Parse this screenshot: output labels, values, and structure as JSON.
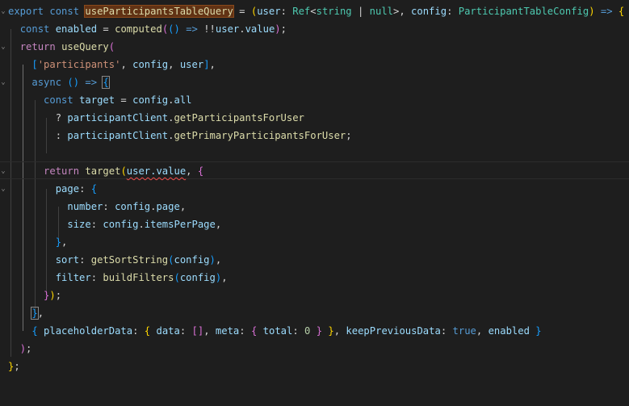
{
  "editor": {
    "theme_colors": {
      "background": "#1e1e1e",
      "keyword": "#569cd6",
      "control": "#c586c0",
      "function": "#dcdcaa",
      "variable": "#9cdcfe",
      "type": "#4ec9b0",
      "string": "#ce9178",
      "number": "#b5cea8"
    },
    "lines": [
      {
        "fold": "chevron-down-icon",
        "tokens": [
          {
            "c": "kw",
            "t": "export"
          },
          {
            "c": "plain",
            "t": " "
          },
          {
            "c": "kw",
            "t": "const"
          },
          {
            "c": "plain",
            "t": " "
          },
          {
            "c": "fn hl",
            "t": "useParticipantsTableQuery"
          },
          {
            "c": "plain",
            "t": " = "
          },
          {
            "c": "b1",
            "t": "("
          },
          {
            "c": "var",
            "t": "user"
          },
          {
            "c": "plain",
            "t": ": "
          },
          {
            "c": "type",
            "t": "Ref"
          },
          {
            "c": "plain",
            "t": "<"
          },
          {
            "c": "type",
            "t": "string"
          },
          {
            "c": "plain",
            "t": " | "
          },
          {
            "c": "type",
            "t": "null"
          },
          {
            "c": "plain",
            "t": ">, "
          },
          {
            "c": "var",
            "t": "config"
          },
          {
            "c": "plain",
            "t": ": "
          },
          {
            "c": "type",
            "t": "ParticipantTableConfig"
          },
          {
            "c": "b1",
            "t": ")"
          },
          {
            "c": "plain",
            "t": " "
          },
          {
            "c": "kw",
            "t": "=>"
          },
          {
            "c": "plain",
            "t": " "
          },
          {
            "c": "b1",
            "t": "{"
          }
        ]
      },
      {
        "fold": "",
        "tokens": [
          {
            "c": "plain",
            "t": "  "
          },
          {
            "c": "kw",
            "t": "const"
          },
          {
            "c": "plain",
            "t": " "
          },
          {
            "c": "var",
            "t": "enabled"
          },
          {
            "c": "plain",
            "t": " = "
          },
          {
            "c": "fn",
            "t": "computed"
          },
          {
            "c": "b2",
            "t": "("
          },
          {
            "c": "b3",
            "t": "()"
          },
          {
            "c": "plain",
            "t": " "
          },
          {
            "c": "kw",
            "t": "=>"
          },
          {
            "c": "plain",
            "t": " !!"
          },
          {
            "c": "var",
            "t": "user"
          },
          {
            "c": "plain",
            "t": "."
          },
          {
            "c": "var",
            "t": "value"
          },
          {
            "c": "b2",
            "t": ")"
          },
          {
            "c": "plain",
            "t": ";"
          }
        ]
      },
      {
        "fold": "chevron-down-icon",
        "tokens": [
          {
            "c": "plain",
            "t": "  "
          },
          {
            "c": "ctl",
            "t": "return"
          },
          {
            "c": "plain",
            "t": " "
          },
          {
            "c": "fn",
            "t": "useQuery"
          },
          {
            "c": "b2",
            "t": "("
          }
        ]
      },
      {
        "fold": "",
        "tokens": [
          {
            "c": "plain",
            "t": "    "
          },
          {
            "c": "b3",
            "t": "["
          },
          {
            "c": "str",
            "t": "'participants'"
          },
          {
            "c": "plain",
            "t": ", "
          },
          {
            "c": "var",
            "t": "config"
          },
          {
            "c": "plain",
            "t": ", "
          },
          {
            "c": "var",
            "t": "user"
          },
          {
            "c": "b3",
            "t": "]"
          },
          {
            "c": "plain",
            "t": ","
          }
        ]
      },
      {
        "fold": "chevron-down-icon",
        "tokens": [
          {
            "c": "plain",
            "t": "    "
          },
          {
            "c": "kw",
            "t": "async"
          },
          {
            "c": "plain",
            "t": " "
          },
          {
            "c": "b3",
            "t": "()"
          },
          {
            "c": "plain",
            "t": " "
          },
          {
            "c": "kw",
            "t": "=>"
          },
          {
            "c": "plain",
            "t": " "
          },
          {
            "c": "b3 bm",
            "t": "{"
          }
        ]
      },
      {
        "fold": "",
        "tokens": [
          {
            "c": "plain",
            "t": "      "
          },
          {
            "c": "kw",
            "t": "const"
          },
          {
            "c": "plain",
            "t": " "
          },
          {
            "c": "var",
            "t": "target"
          },
          {
            "c": "plain",
            "t": " = "
          },
          {
            "c": "var",
            "t": "config"
          },
          {
            "c": "plain",
            "t": "."
          },
          {
            "c": "var",
            "t": "all"
          }
        ]
      },
      {
        "fold": "",
        "tokens": [
          {
            "c": "plain",
            "t": "        ? "
          },
          {
            "c": "var",
            "t": "participantClient"
          },
          {
            "c": "plain",
            "t": "."
          },
          {
            "c": "fn",
            "t": "getParticipantsForUser"
          }
        ]
      },
      {
        "fold": "",
        "tokens": [
          {
            "c": "plain",
            "t": "        : "
          },
          {
            "c": "var",
            "t": "participantClient"
          },
          {
            "c": "plain",
            "t": "."
          },
          {
            "c": "fn",
            "t": "getPrimaryParticipantsForUser"
          },
          {
            "c": "plain",
            "t": ";"
          }
        ]
      },
      {
        "fold": "",
        "tokens": []
      },
      {
        "fold": "chevron-down-icon",
        "tokens": [
          {
            "c": "plain",
            "t": "      "
          },
          {
            "c": "ctl",
            "t": "return"
          },
          {
            "c": "plain",
            "t": " "
          },
          {
            "c": "fn",
            "t": "target"
          },
          {
            "c": "b1",
            "t": "("
          },
          {
            "c": "var squig",
            "t": "user.value"
          },
          {
            "c": "plain",
            "t": ", "
          },
          {
            "c": "b2",
            "t": "{"
          }
        ]
      },
      {
        "fold": "chevron-down-icon",
        "tokens": [
          {
            "c": "plain",
            "t": "        "
          },
          {
            "c": "var",
            "t": "page"
          },
          {
            "c": "plain",
            "t": ": "
          },
          {
            "c": "b3",
            "t": "{"
          }
        ]
      },
      {
        "fold": "",
        "tokens": [
          {
            "c": "plain",
            "t": "          "
          },
          {
            "c": "var",
            "t": "number"
          },
          {
            "c": "plain",
            "t": ": "
          },
          {
            "c": "var",
            "t": "config"
          },
          {
            "c": "plain",
            "t": "."
          },
          {
            "c": "var",
            "t": "page"
          },
          {
            "c": "plain",
            "t": ","
          }
        ]
      },
      {
        "fold": "",
        "tokens": [
          {
            "c": "plain",
            "t": "          "
          },
          {
            "c": "var",
            "t": "size"
          },
          {
            "c": "plain",
            "t": ": "
          },
          {
            "c": "var",
            "t": "config"
          },
          {
            "c": "plain",
            "t": "."
          },
          {
            "c": "var",
            "t": "itemsPerPage"
          },
          {
            "c": "plain",
            "t": ","
          }
        ]
      },
      {
        "fold": "",
        "tokens": [
          {
            "c": "plain",
            "t": "        "
          },
          {
            "c": "b3",
            "t": "}"
          },
          {
            "c": "plain",
            "t": ","
          }
        ]
      },
      {
        "fold": "",
        "tokens": [
          {
            "c": "plain",
            "t": "        "
          },
          {
            "c": "var",
            "t": "sort"
          },
          {
            "c": "plain",
            "t": ": "
          },
          {
            "c": "fn",
            "t": "getSortString"
          },
          {
            "c": "b3",
            "t": "("
          },
          {
            "c": "var",
            "t": "config"
          },
          {
            "c": "b3",
            "t": ")"
          },
          {
            "c": "plain",
            "t": ","
          }
        ]
      },
      {
        "fold": "",
        "tokens": [
          {
            "c": "plain",
            "t": "        "
          },
          {
            "c": "var",
            "t": "filter"
          },
          {
            "c": "plain",
            "t": ": "
          },
          {
            "c": "fn",
            "t": "buildFilters"
          },
          {
            "c": "b3",
            "t": "("
          },
          {
            "c": "var",
            "t": "config"
          },
          {
            "c": "b3",
            "t": ")"
          },
          {
            "c": "plain",
            "t": ","
          }
        ]
      },
      {
        "fold": "",
        "tokens": [
          {
            "c": "plain",
            "t": "      "
          },
          {
            "c": "b2",
            "t": "}"
          },
          {
            "c": "b1",
            "t": ")"
          },
          {
            "c": "plain",
            "t": ";"
          }
        ]
      },
      {
        "fold": "",
        "tokens": [
          {
            "c": "plain",
            "t": "    "
          },
          {
            "c": "b3 bm",
            "t": "}"
          },
          {
            "c": "plain",
            "t": ","
          }
        ]
      },
      {
        "fold": "",
        "tokens": [
          {
            "c": "plain",
            "t": "    "
          },
          {
            "c": "b3",
            "t": "{"
          },
          {
            "c": "plain",
            "t": " "
          },
          {
            "c": "var",
            "t": "placeholderData"
          },
          {
            "c": "plain",
            "t": ": "
          },
          {
            "c": "b1",
            "t": "{"
          },
          {
            "c": "plain",
            "t": " "
          },
          {
            "c": "var",
            "t": "data"
          },
          {
            "c": "plain",
            "t": ": "
          },
          {
            "c": "b2",
            "t": "[]"
          },
          {
            "c": "plain",
            "t": ", "
          },
          {
            "c": "var",
            "t": "meta"
          },
          {
            "c": "plain",
            "t": ": "
          },
          {
            "c": "b2",
            "t": "{"
          },
          {
            "c": "plain",
            "t": " "
          },
          {
            "c": "var",
            "t": "total"
          },
          {
            "c": "plain",
            "t": ": "
          },
          {
            "c": "num",
            "t": "0"
          },
          {
            "c": "plain",
            "t": " "
          },
          {
            "c": "b2",
            "t": "}"
          },
          {
            "c": "plain",
            "t": " "
          },
          {
            "c": "b1",
            "t": "}"
          },
          {
            "c": "plain",
            "t": ", "
          },
          {
            "c": "var",
            "t": "keepPreviousData"
          },
          {
            "c": "plain",
            "t": ": "
          },
          {
            "c": "kw",
            "t": "true"
          },
          {
            "c": "plain",
            "t": ", "
          },
          {
            "c": "var",
            "t": "enabled"
          },
          {
            "c": "plain",
            "t": " "
          },
          {
            "c": "b3",
            "t": "}"
          }
        ]
      },
      {
        "fold": "",
        "tokens": [
          {
            "c": "plain",
            "t": "  "
          },
          {
            "c": "b2",
            "t": ")"
          },
          {
            "c": "plain",
            "t": ";"
          }
        ]
      },
      {
        "fold": "",
        "tokens": [
          {
            "c": "b1",
            "t": "}"
          },
          {
            "c": "plain",
            "t": ";"
          }
        ]
      }
    ]
  }
}
